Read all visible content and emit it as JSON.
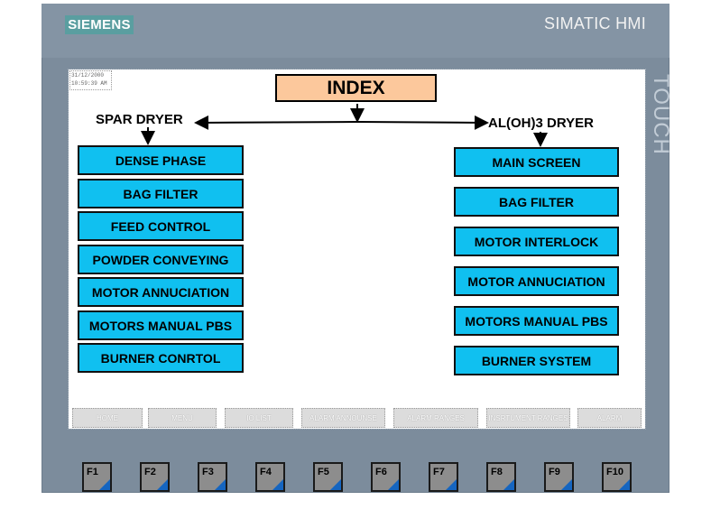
{
  "panel": {
    "brand": "SIEMENS",
    "model": "SIMATIC HMI",
    "touch_label": "TOUCH"
  },
  "screen": {
    "datetime_date": "31/12/2000",
    "datetime_time": "10:59:39 AM",
    "title": "INDEX",
    "left_section": {
      "title": "SPAR DRYER",
      "buttons": [
        "DENSE PHASE",
        "BAG FILTER",
        "FEED CONTROL",
        "POWDER CONVEYING",
        "MOTOR ANNUCIATION",
        "MOTORS MANUAL PBS",
        "BURNER CONRTOL"
      ]
    },
    "right_section": {
      "title": "AL(OH)3 DRYER",
      "buttons": [
        "MAIN SCREEN",
        "BAG FILTER",
        "MOTOR INTERLOCK",
        "MOTOR ANNUCIATION",
        "MOTORS MANUAL PBS",
        "BURNER SYSTEM"
      ]
    },
    "function_bar": [
      "HOME",
      "MENU",
      "IO LIST",
      "ALARM ANNOUNSE",
      "ALARM RANGES",
      "INSRTUMENT RANGES",
      "ALARM"
    ]
  },
  "function_keys": [
    "F1",
    "F2",
    "F3",
    "F4",
    "F5",
    "F6",
    "F7",
    "F8",
    "F9",
    "F10"
  ],
  "colors": {
    "bezel": "#7c8c9c",
    "button_fill": "#10c0f0",
    "index_fill": "#fcc89c",
    "fkey_accent": "#1565c0"
  }
}
